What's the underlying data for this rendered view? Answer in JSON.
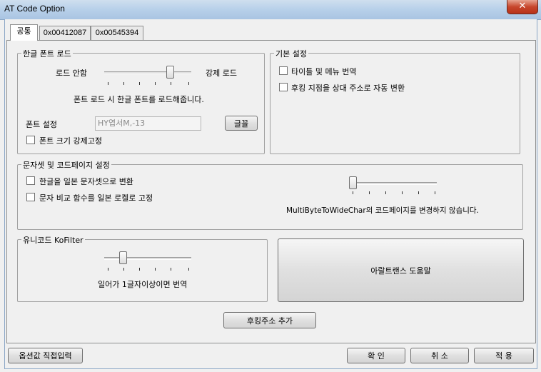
{
  "window": {
    "title": "AT Code Option",
    "close_glyph": "✕"
  },
  "tabs": [
    {
      "label": "공통",
      "active": true
    },
    {
      "label": "0x00412087",
      "active": false
    },
    {
      "label": "0x00545394",
      "active": false
    }
  ],
  "font_load": {
    "title": "한글 폰트 로드",
    "left_label": "로드 안함",
    "right_label": "강제 로드",
    "slider_value": 4,
    "description": "폰트 로드 시 한글 폰트를 로드해줍니다.",
    "font_setting_label": "폰트 설정",
    "font_value": "HY엽서M,-13",
    "font_button": "글꼴",
    "fix_size_label": "폰트 크기 강제고정"
  },
  "basic": {
    "title": "기본 설정",
    "options": [
      "타이틀 및 메뉴 번역",
      "후킹 지점을 상대 주소로 자동 변환"
    ]
  },
  "charset": {
    "title": "문자셋 및 코드페이지 설정",
    "options": [
      "한글을 일본 문자셋으로 변환",
      "문자 비교 함수를 일본 로켈로 고정"
    ],
    "slider_value": 0,
    "description": "MultiByteToWideChar의 코드페이지를 변경하지 않습니다."
  },
  "unicode": {
    "title": "유니코드 KoFilter",
    "slider_value": 1,
    "description": "일어가 1글자이상이면 번역"
  },
  "help_button": "아랄트랜스 도움말",
  "add_hook_button": "후킹주소 추가",
  "footer": {
    "direct_input": "옵션값 직접입력",
    "ok": "확 인",
    "cancel": "취 소",
    "apply": "적 용"
  }
}
